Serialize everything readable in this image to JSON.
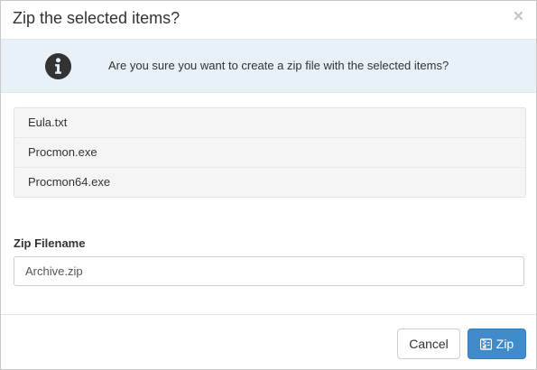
{
  "dialog": {
    "title": "Zip the selected items?",
    "close_glyph": "×"
  },
  "alert": {
    "icon": "info-icon",
    "message": "Are you sure you want to create a zip file with the selected items?"
  },
  "files": [
    "Eula.txt",
    "Procmon.exe",
    "Procmon64.exe"
  ],
  "form": {
    "label": "Zip Filename",
    "value": "Archive.zip"
  },
  "footer": {
    "cancel_label": "Cancel",
    "zip_label": "Zip",
    "zip_icon": "archive-icon"
  },
  "colors": {
    "alert_bg": "#e8f1f8",
    "primary": "#428bca",
    "list_bg": "#f5f5f5"
  }
}
